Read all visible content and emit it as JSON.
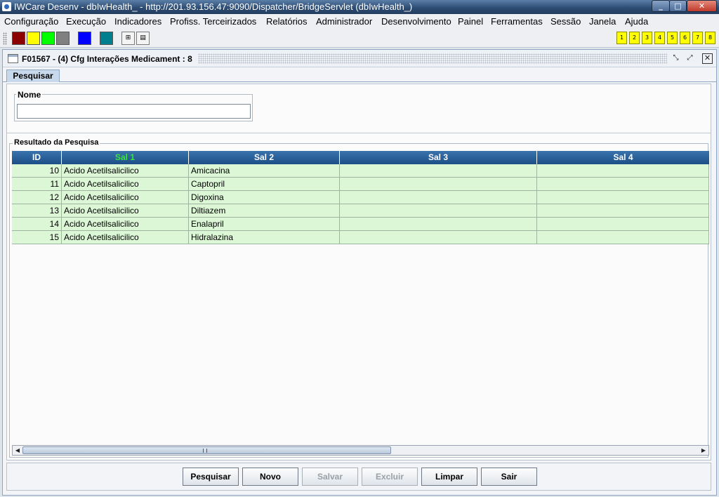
{
  "window": {
    "title": "IWCare Desenv - dbIwHealth_ - http://201.93.156.47:9090/Dispatcher/BridgeServlet (dbIwHealth_)"
  },
  "menu": [
    "Configuração",
    "Execução",
    "Indicadores",
    "Profiss. Terceirizados",
    "Relatórios",
    "Administrador",
    "Desenvolvimento",
    "Painel",
    "Ferramentas",
    "Sessão",
    "Janela",
    "Ajuda"
  ],
  "toolbar": {
    "colors": [
      "#8b0000",
      "#ffff00",
      "#00ff00",
      "#808080",
      "#0000ff",
      "#007f8f"
    ],
    "numbers": [
      "1",
      "2",
      "3",
      "4",
      "5",
      "6",
      "7",
      "8"
    ]
  },
  "frame": {
    "title": "F01567 - (4) Cfg Interações Medicament : 8",
    "tab": "Pesquisar"
  },
  "search": {
    "legend": "Nome",
    "value": ""
  },
  "results": {
    "legend": "Resultado da Pesquisa",
    "columns": [
      "ID",
      "Sal 1",
      "Sal 2",
      "Sal 3",
      "Sal 4"
    ],
    "rows": [
      [
        "10",
        "Acido Acetilsalicilico",
        "Amicacina",
        "",
        ""
      ],
      [
        "11",
        "Acido Acetilsalicilico",
        "Captopril",
        "",
        ""
      ],
      [
        "12",
        "Acido Acetilsalicilico",
        "Digoxina",
        "",
        ""
      ],
      [
        "13",
        "Acido Acetilsalicilico",
        "Diltiazem",
        "",
        ""
      ],
      [
        "14",
        "Acido Acetilsalicilico",
        "Enalapril",
        "",
        ""
      ],
      [
        "15",
        "Acido Acetilsalicilico",
        "Hidralazina",
        "",
        ""
      ]
    ]
  },
  "buttons": {
    "pesquisar": "Pesquisar",
    "novo": "Novo",
    "salvar": "Salvar",
    "excluir": "Excluir",
    "limpar": "Limpar",
    "sair": "Sair"
  }
}
